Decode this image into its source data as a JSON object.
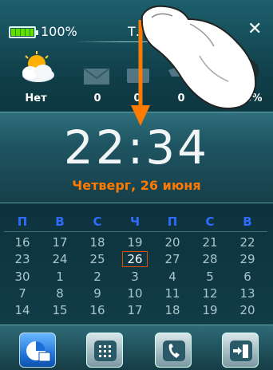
{
  "status": {
    "battery_percent": 100,
    "battery_text": "100%",
    "status_text": "Т...   ючен",
    "close_label": "✕"
  },
  "widgets": [
    {
      "icon": "weather-sun-cloud-icon",
      "label": "Нет"
    },
    {
      "icon": "email-icon",
      "label": "0"
    },
    {
      "icon": "sms-icon",
      "label": "0"
    },
    {
      "icon": "missed-call-icon",
      "label": "0"
    },
    {
      "icon": "signal-icon",
      "label": "80%"
    }
  ],
  "clock": {
    "time": "22:34",
    "date": "Четверг, 26 июня"
  },
  "calendar": {
    "weekdays": [
      "П",
      "В",
      "С",
      "Ч",
      "П",
      "С",
      "В"
    ],
    "weeks": [
      [
        "16",
        "17",
        "18",
        "19",
        "20",
        "21",
        "22"
      ],
      [
        "23",
        "24",
        "25",
        "26",
        "27",
        "28",
        "29"
      ],
      [
        "30",
        "1",
        "2",
        "3",
        "4",
        "5",
        "6"
      ],
      [
        "7",
        "8",
        "9",
        "10",
        "11",
        "12",
        "13"
      ],
      [
        "14",
        "15",
        "16",
        "17",
        "18",
        "19",
        "20"
      ]
    ],
    "today": "26"
  },
  "dock": [
    {
      "icon": "calendar-app-icon",
      "active": true
    },
    {
      "icon": "apps-grid-icon",
      "active": false
    },
    {
      "icon": "phone-icon",
      "active": false
    },
    {
      "icon": "exit-icon",
      "active": false
    }
  ],
  "colors": {
    "accent_orange": "#ff7a00",
    "weekday_blue": "#2f6bff",
    "today_border": "#e05000"
  }
}
